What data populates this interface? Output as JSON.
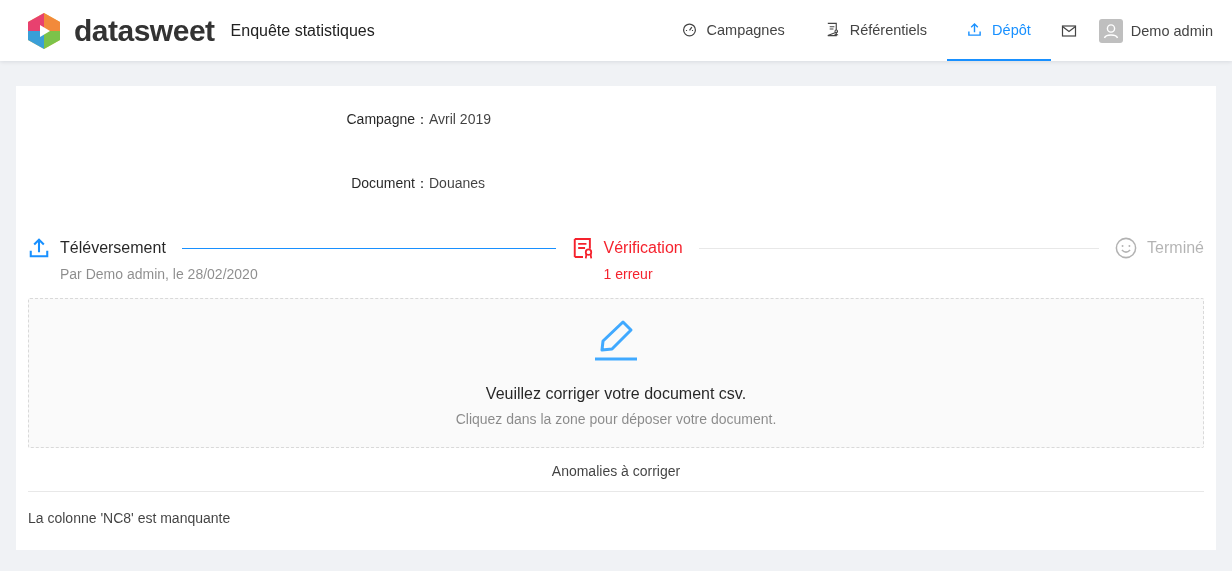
{
  "header": {
    "brand": "datasweet",
    "app_title": "Enquête statistiques",
    "nav": [
      {
        "kind": "dashboard",
        "label": "Campagnes",
        "selected": false
      },
      {
        "kind": "document",
        "label": "Référentiels",
        "selected": false
      },
      {
        "kind": "upload",
        "label": "Dépôt",
        "selected": true
      }
    ],
    "user": "Demo admin"
  },
  "details": [
    {
      "label": "Campagne：",
      "value": "Avril 2019"
    },
    {
      "label": "Document：",
      "value": "Douanes"
    }
  ],
  "steps": [
    {
      "kind": "upload",
      "done": true,
      "error": false,
      "title": "Téléversement",
      "description": "Par Demo admin, le 28/02/2020"
    },
    {
      "kind": "certificate",
      "done": false,
      "error": true,
      "title": "Vérification",
      "description": "1 erreur"
    },
    {
      "kind": "smile",
      "done": false,
      "error": false,
      "title": "Terminé"
    }
  ],
  "dropzone": {
    "title": "Veuillez corriger votre document csv.",
    "hint": "Cliquez dans la zone pour déposer votre document."
  },
  "anomalies": {
    "heading": "Anomalies à corriger",
    "items": [
      "La colonne 'NC8' est manquante"
    ]
  }
}
